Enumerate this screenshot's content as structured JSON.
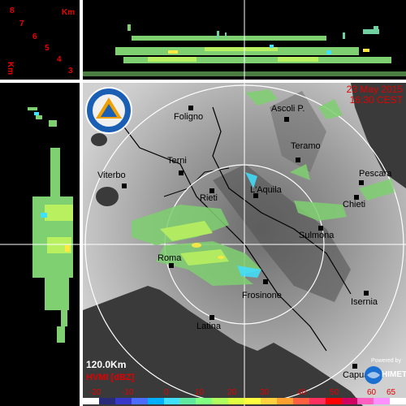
{
  "header": {
    "datetime_line1": "23 May 2015",
    "datetime_line2": "16:30 CEST"
  },
  "height_scale": {
    "unit": "Km",
    "unit_vertical": "Km",
    "ticks": [
      "8",
      "7",
      "6",
      "5",
      "4",
      "3"
    ]
  },
  "map": {
    "range_label": "120.0Km",
    "product_label": "HVMI [dBZ]",
    "powered_by": "Powered by",
    "vendor": "HIMET",
    "logo_text": "PROTEZIONE CIVILE REGIONE ABRUZZO",
    "cities": [
      {
        "name": "Foligno"
      },
      {
        "name": "Ascoli P."
      },
      {
        "name": "Teramo"
      },
      {
        "name": "Terni"
      },
      {
        "name": "Viterbo"
      },
      {
        "name": "Pescara"
      },
      {
        "name": "Rieti"
      },
      {
        "name": "L'Aquila"
      },
      {
        "name": "Chieti"
      },
      {
        "name": "Sulmona"
      },
      {
        "name": "Roma"
      },
      {
        "name": "Frosinone"
      },
      {
        "name": "Isernia"
      },
      {
        "name": "Latina"
      },
      {
        "name": "Capua"
      }
    ]
  },
  "legend": {
    "labels": [
      "-20",
      "-10",
      "0",
      "10",
      "20",
      "30",
      "40",
      "50",
      "60",
      "65"
    ],
    "colors": [
      "#ffffff",
      "#2a2a7a",
      "#3838c8",
      "#4a6cff",
      "#00b0ff",
      "#40e0ff",
      "#60e8a0",
      "#80ff80",
      "#b0ff60",
      "#e0ff40",
      "#ffff40",
      "#ffd040",
      "#ffa030",
      "#ff6040",
      "#ff3060",
      "#ff0000",
      "#d00060",
      "#ff60c0",
      "#ff90ff",
      "#ffffff"
    ]
  }
}
